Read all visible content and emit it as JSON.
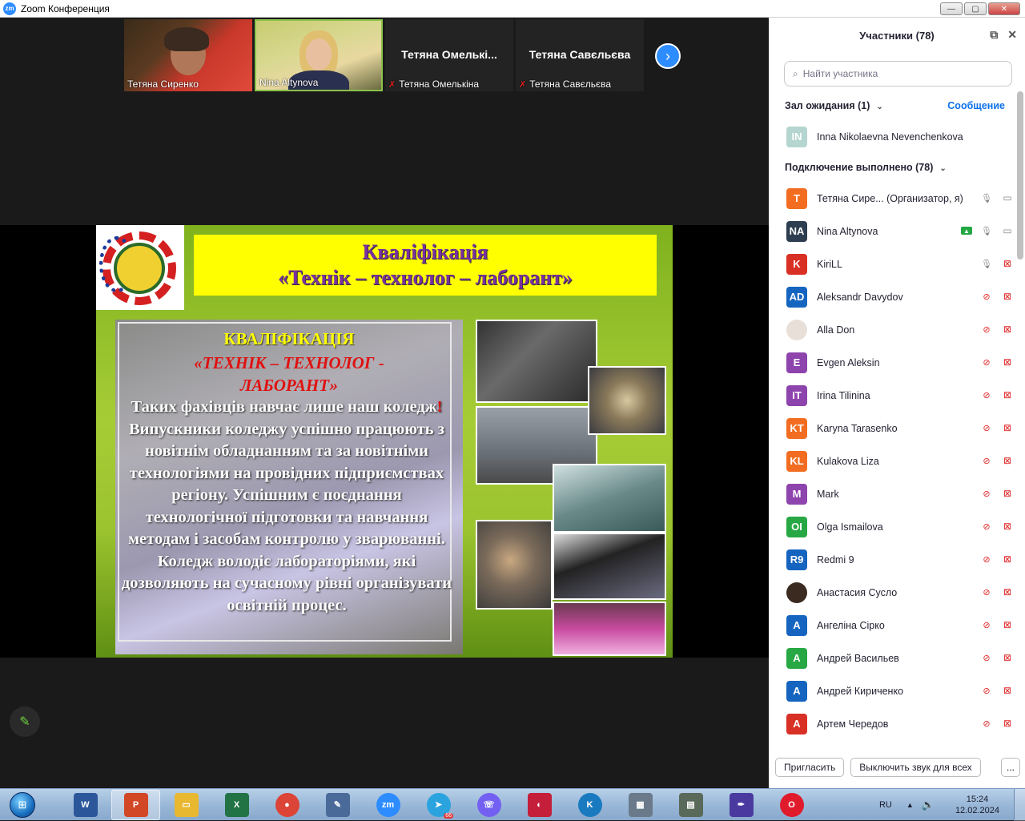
{
  "window": {
    "title": "Zoom Конференция",
    "app_icon": "zm"
  },
  "thumbnails": [
    {
      "name": "Тетяна Сиренко",
      "video": true,
      "muted": false
    },
    {
      "name": "Nina Altynova",
      "video": true,
      "muted": false
    },
    {
      "name": "Тетяна Омелькіна",
      "display": "Тетяна  Омелькі...",
      "video": false,
      "muted": true
    },
    {
      "name": "Тетяна Савєльєва",
      "display": "Тетяна Савєльєва",
      "video": false,
      "muted": true
    }
  ],
  "slide": {
    "title_line1": "Кваліфікація",
    "title_line2": "«Технік – технолог – лаборант»",
    "panel_heading": "КВАЛІФІКАЦІЯ",
    "panel_subheading": "«ТЕХНІК – ТЕХНОЛОГ - ЛАБОРАНТ»",
    "body_part1": "Таких фахівців навчає лише наш коледж",
    "body_excl": "!",
    "body_part2": " Випускники коледжу успішно працюють з новітнім обладнанням та за новітніми технологіями на провідних підприємствах регіону. Успішним є поєднання технологічної підготовки та навчання методам і засобам контролю у зварюванні. Коледж володіє лабораторіями, які дозволяють на сучасному рівні організувати освітній процес."
  },
  "participants_panel": {
    "title": "Участники (78)",
    "search_placeholder": "Найти участника",
    "waiting_label": "Зал ожидания (1)",
    "message_link": "Сообщение",
    "waiting": [
      {
        "initials": "IN",
        "name": "Inna Nikolaevna Nevenchenkova",
        "color": "#b5d6d0"
      }
    ],
    "connected_label": "Подключение выполнено (78)",
    "participants": [
      {
        "initials": "T",
        "name": "Тетяна Сире...  (Организатор, я)",
        "color": "#f26d21",
        "mic": "on",
        "cam": "on"
      },
      {
        "initials": "NA",
        "name": "Nina Altynova",
        "color": "#2d3e50",
        "mic": "on",
        "cam": "on",
        "share": true
      },
      {
        "initials": "K",
        "name": "KiriLL",
        "color": "#d93025",
        "mic": "on",
        "cam": "off"
      },
      {
        "initials": "AD",
        "name": "Aleksandr Davydov",
        "color": "#1565c0",
        "mic": "off",
        "cam": "off"
      },
      {
        "initials": "",
        "name": "Alla Don",
        "color": "#e8e0d8",
        "photo": true,
        "mic": "off",
        "cam": "off"
      },
      {
        "initials": "E",
        "name": "Evgen Aleksin",
        "color": "#8e44ad",
        "mic": "off",
        "cam": "off"
      },
      {
        "initials": "IT",
        "name": "Irina Tilinina",
        "color": "#8e44ad",
        "mic": "off",
        "cam": "off"
      },
      {
        "initials": "KT",
        "name": "Karyna Tarasenko",
        "color": "#f26d21",
        "mic": "off",
        "cam": "off"
      },
      {
        "initials": "KL",
        "name": "Kulakova Liza",
        "color": "#f26d21",
        "mic": "off",
        "cam": "off"
      },
      {
        "initials": "M",
        "name": "Mark",
        "color": "#8e44ad",
        "mic": "off",
        "cam": "off"
      },
      {
        "initials": "OI",
        "name": "Olga Ismailova",
        "color": "#27a844",
        "mic": "off",
        "cam": "off"
      },
      {
        "initials": "R9",
        "name": "Redmi 9",
        "color": "#1565c0",
        "mic": "off",
        "cam": "off"
      },
      {
        "initials": "",
        "name": "Анастасия Сусло",
        "color": "#3a2a20",
        "photo": true,
        "mic": "off",
        "cam": "off"
      },
      {
        "initials": "A",
        "name": "Ангеліна Сірко",
        "color": "#1565c0",
        "mic": "off",
        "cam": "off"
      },
      {
        "initials": "A",
        "name": "Андрей Васильев",
        "color": "#27a844",
        "mic": "off",
        "cam": "off"
      },
      {
        "initials": "A",
        "name": "Андрей Кириченко",
        "color": "#1565c0",
        "mic": "off",
        "cam": "off"
      },
      {
        "initials": "A",
        "name": "Артем Чередов",
        "color": "#d93025",
        "mic": "off",
        "cam": "off"
      }
    ],
    "invite_button": "Пригласить",
    "mute_all_button": "Выключить звук для всех",
    "more_button": "..."
  },
  "taskbar": {
    "apps": [
      {
        "name": "word-icon",
        "label": "W",
        "color": "#2b579a"
      },
      {
        "name": "powerpoint-icon",
        "label": "P",
        "color": "#d24726",
        "active": true
      },
      {
        "name": "explorer-icon",
        "label": "▭",
        "color": "#e8b830"
      },
      {
        "name": "excel-icon",
        "label": "X",
        "color": "#217346"
      },
      {
        "name": "chrome-icon",
        "label": "●",
        "color": "#db4437",
        "round": true
      },
      {
        "name": "editor-icon",
        "label": "✎",
        "color": "#4a6a9a"
      },
      {
        "name": "zoom-icon",
        "label": "zm",
        "color": "#2d8cff",
        "round": true
      },
      {
        "name": "telegram-icon",
        "label": "➤",
        "color": "#2aa3df",
        "round": true,
        "badge": "66"
      },
      {
        "name": "viber-icon",
        "label": "☏",
        "color": "#7360f2",
        "round": true
      },
      {
        "name": "red-app-icon",
        "label": "◐",
        "color": "#c41e3a"
      },
      {
        "name": "k-app-icon",
        "label": "K",
        "color": "#1a7ac0",
        "round": true
      },
      {
        "name": "calculator-icon",
        "label": "▦",
        "color": "#6a7a8a"
      },
      {
        "name": "scanner-icon",
        "label": "▤",
        "color": "#5a6a5a"
      },
      {
        "name": "pen-app-icon",
        "label": "✒",
        "color": "#4a3aa0"
      },
      {
        "name": "opera-icon",
        "label": "O",
        "color": "#e01b2b",
        "round": true
      }
    ],
    "language": "RU",
    "time": "15:24",
    "date": "12.02.2024"
  }
}
